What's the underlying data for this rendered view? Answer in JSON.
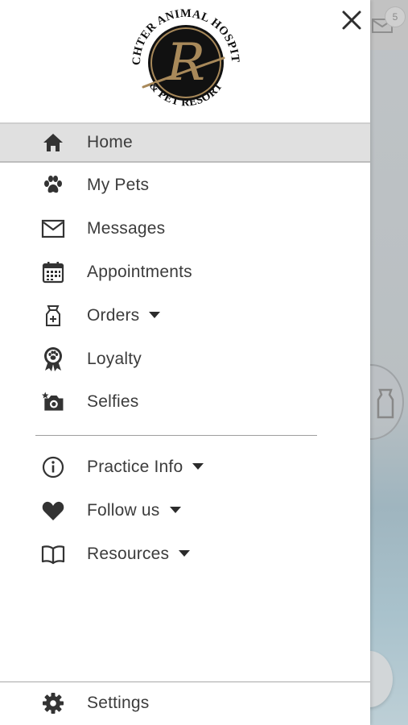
{
  "background_app": {
    "mail_badge_count": "5"
  },
  "drawer": {
    "logo": {
      "top_text": "RICHTER ANIMAL HOSPITAL",
      "bottom_text": "& PET RESORT",
      "monogram": "R"
    },
    "menu": [
      {
        "label": "Home",
        "icon": "home-icon",
        "active": true
      },
      {
        "label": "My Pets",
        "icon": "paw-icon"
      },
      {
        "label": "Messages",
        "icon": "envelope-icon"
      },
      {
        "label": "Appointments",
        "icon": "calendar-icon"
      },
      {
        "label": "Orders",
        "icon": "food-bag-icon",
        "has_dropdown": true
      },
      {
        "label": "Loyalty",
        "icon": "award-ribbon-icon"
      },
      {
        "label": "Selfies",
        "icon": "camera-icon"
      }
    ],
    "secondary_menu": [
      {
        "label": "Practice Info",
        "icon": "info-icon",
        "has_dropdown": true
      },
      {
        "label": "Follow us",
        "icon": "heart-icon",
        "has_dropdown": true
      },
      {
        "label": "Resources",
        "icon": "book-icon",
        "has_dropdown": true
      }
    ],
    "footer": {
      "label": "Settings",
      "icon": "gear-icon"
    }
  },
  "colors": {
    "active_row_bg": "#e0e0e0",
    "icon": "#333333",
    "text": "#3c3c3c",
    "logo_gold": "#a8895a"
  }
}
